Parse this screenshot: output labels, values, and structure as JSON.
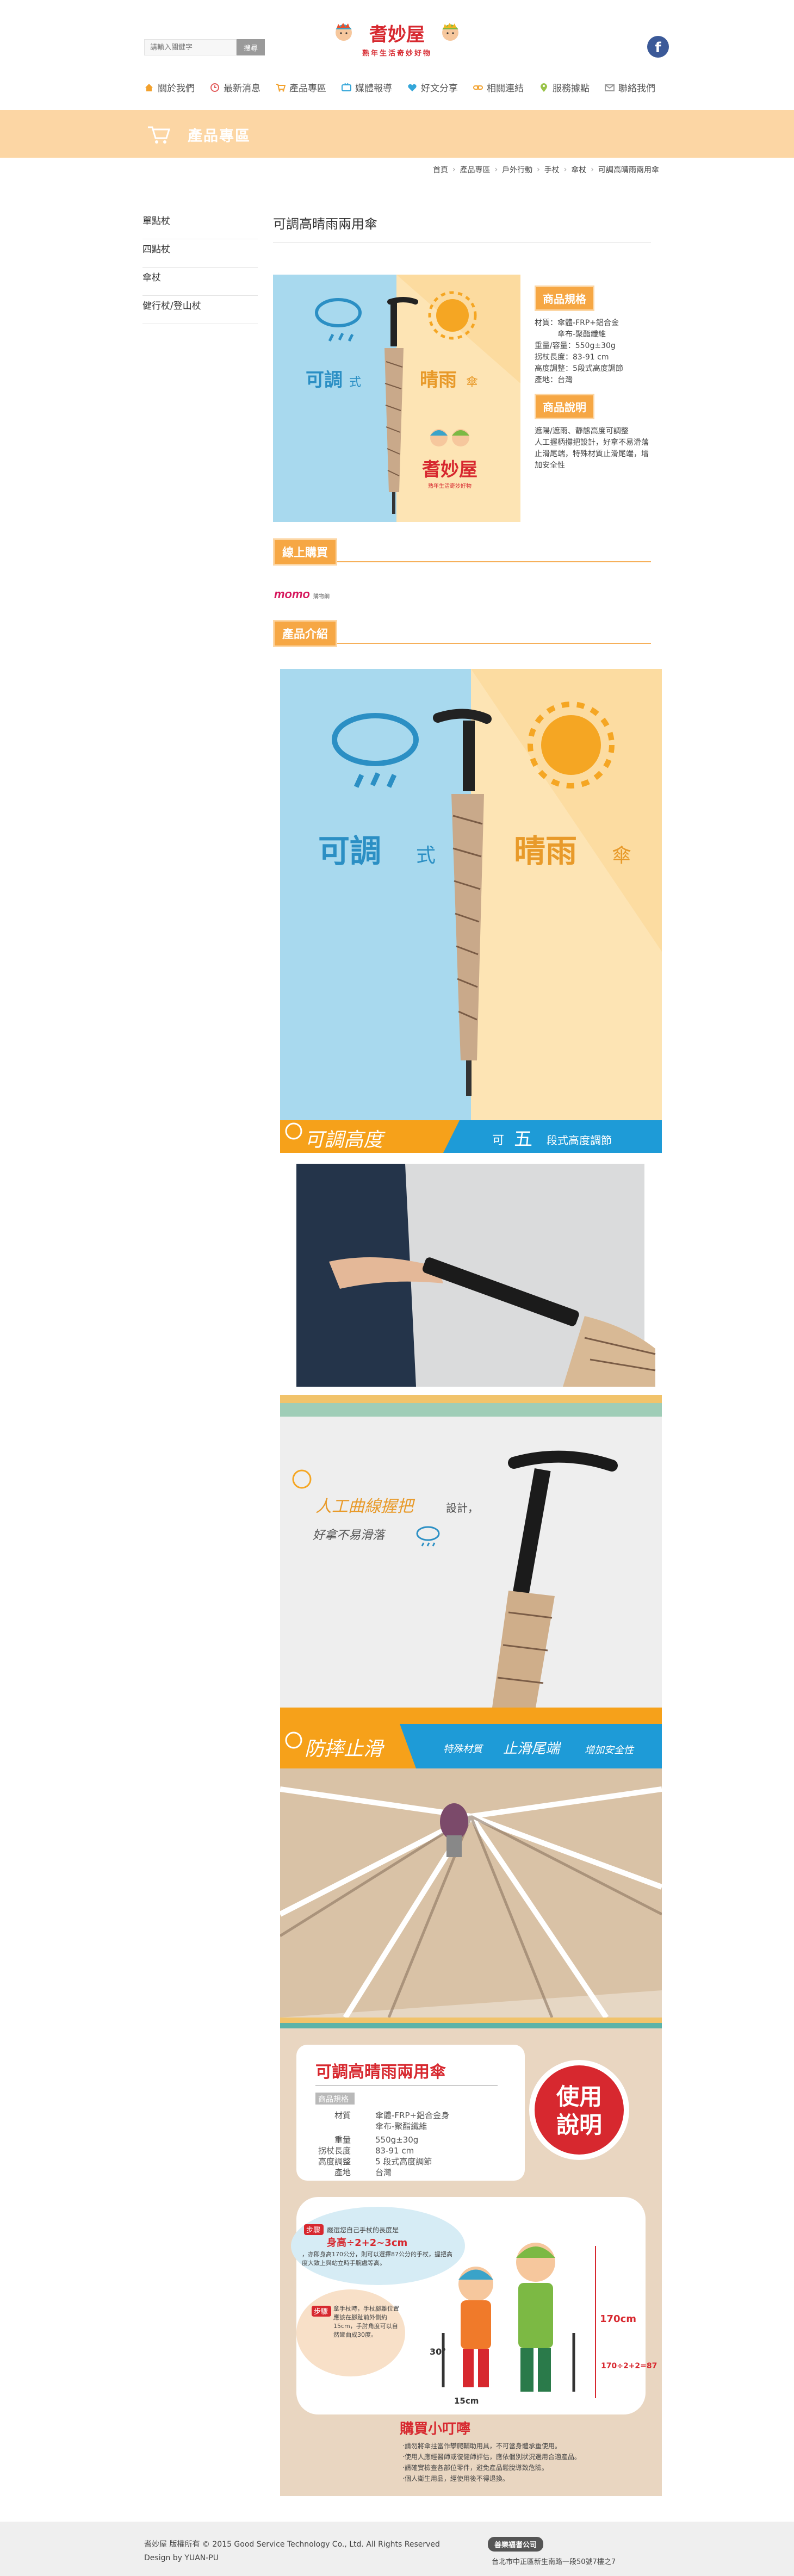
{
  "header": {
    "search_placeholder": "請輸入關鍵字",
    "search_button": "搜尋",
    "logo_text": "耆妙屋",
    "logo_tagline": "熟年生活奇妙好物",
    "facebook_glyph": "f"
  },
  "nav": [
    {
      "label": "關於我們",
      "icon": "house-icon",
      "color": "#f2a12c"
    },
    {
      "label": "最新消息",
      "icon": "news-icon",
      "color": "#e25d5d"
    },
    {
      "label": "產品專區",
      "icon": "cart-icon",
      "color": "#f2a12c"
    },
    {
      "label": "媒體報導",
      "icon": "tv-icon",
      "color": "#34a6d9"
    },
    {
      "label": "好文分享",
      "icon": "heart-icon",
      "color": "#34a6d9"
    },
    {
      "label": "相關連結",
      "icon": "link-icon",
      "color": "#f2a12c"
    },
    {
      "label": "服務據點",
      "icon": "pin-icon",
      "color": "#9ac34a"
    },
    {
      "label": "聯絡我們",
      "icon": "mail-icon",
      "color": "#999999"
    }
  ],
  "banner": {
    "title": "產品專區"
  },
  "breadcrumb": [
    "首頁",
    "產品專區",
    "戶外行動",
    "手杖",
    "傘杖",
    "可調高晴雨兩用傘"
  ],
  "sidebar": [
    "單點杖",
    "四點杖",
    "傘杖",
    "健行杖/登山杖"
  ],
  "product": {
    "title": "可調高晴雨兩用傘",
    "thumb_left_text": "可調",
    "thumb_left_small": "式",
    "thumb_right_text": "晴雨",
    "thumb_right_small": "傘",
    "spec_tag": "商品規格",
    "spec_lines": [
      "材質：傘體-FRP+鋁合金",
      "　　　傘布-聚酯纖維",
      "重量/容量：550g±30g",
      "拐杖長度：83-91 cm",
      "高度調整：5段式高度調節",
      "產地：台灣"
    ],
    "desc_tag": "商品說明",
    "desc_lines": [
      "遮陽/遮雨、靜態高度可調整",
      "人工握柄撐把設計，好拿不易滑落",
      "止滑尾端，特殊材質止滑尾端，增加安全性"
    ]
  },
  "buy_online": {
    "tag": "線上購買",
    "store": "momo",
    "store_sub": "購物網"
  },
  "intro": {
    "tag": "產品介紹",
    "hero_left": "可調",
    "hero_left_small": "式",
    "hero_right": "晴雨",
    "hero_right_small": "傘",
    "adj_title": "可調高度",
    "adj_sub_prefix": "可",
    "adj_sub_num": "五",
    "adj_sub_suffix": "段式高度調節",
    "grip_line1": "人工曲線握把",
    "grip_line1_suffix": "設計，",
    "grip_line2": "好拿不易滑落",
    "slip_title": "防摔止滑",
    "slip_sub1": "特殊材質",
    "slip_sub2": "止滑尾端",
    "slip_sub3": "增加安全性",
    "card_title": "可調高晴雨兩用傘",
    "card_spec_tag": "商品規格",
    "card_spec": [
      {
        "k": "材質",
        "v": "傘體-FRP+鋁合金身"
      },
      {
        "k": "",
        "v": "傘布-聚酯纖維"
      },
      {
        "k": "重量",
        "v": "550g±30g"
      },
      {
        "k": "拐杖長度",
        "v": "83-91 cm"
      },
      {
        "k": "高度調整",
        "v": "5 段式高度調節"
      },
      {
        "k": "產地",
        "v": "台灣"
      }
    ],
    "usage_badge_1": "使用",
    "usage_badge_2": "說明",
    "step1_tag": "步驟",
    "step1_text_a": "嚴選您自己手杖的長度是",
    "step1_text_b": "身高÷2+2~3cm",
    "step1_text_c": "，亦即身高170公分，則可以選擇87公分的手杖，握把高度大致上與站立時手腕處等高。",
    "step2_tag": "步驟",
    "step2_text": "拿手杖時，手杖腳離位置應該在腳趾前外側約15cm，手肘角度可以自然彎曲成30度。",
    "dim_height": "170cm",
    "dim_cane": "170÷2+2=87",
    "dim_angle": "30°",
    "dim_dist": "15cm",
    "tips_title": "購買小叮嚀",
    "tips": [
      "‧請勿將傘拄當作攀爬輔助用具，不可當身體承重使用。",
      "‧使用人應經醫師或復健師評估，應依個別狀況選用合適產品。",
      "‧請確實檢查各部位零件，避免產品鬆脫導致危險。",
      "‧個人衛生用品，經使用後不得退換。"
    ]
  },
  "footer": {
    "copyright": "耆妙屋 版權所有 © 2015 Good Service Technology Co., Ltd. All Rights Reserved",
    "design": "Design by YUAN-PU",
    "badge": "善樂福耆公司",
    "address": "台北市中正區新生南路一段50號7樓之7"
  },
  "colors": {
    "accent_orange": "#f6a744",
    "banner_peach": "#fcd6a4",
    "sky_blue": "#a8d9ee",
    "sun_yellow": "#f5a623",
    "brand_red": "#d7282f"
  }
}
